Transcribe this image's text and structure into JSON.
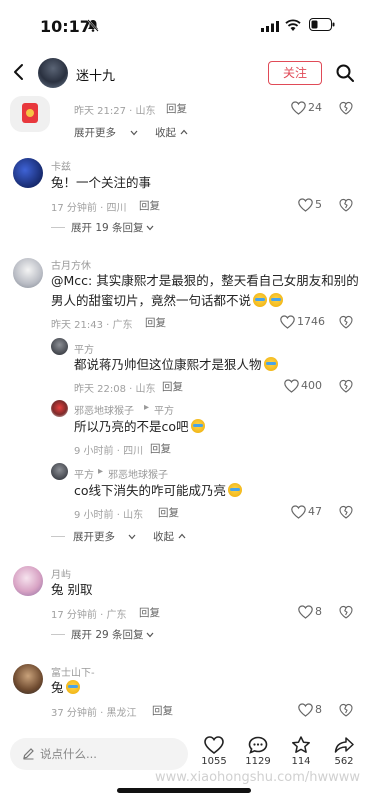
{
  "status": {
    "time": "10:17"
  },
  "header": {
    "name": "迷十九",
    "follow_label": "关注"
  },
  "comments": [
    {
      "meta": "昨天 21:27 · 山东",
      "reply": "回复",
      "likes": "24",
      "expand_more": "展开更多",
      "collapse": "收起"
    },
    {
      "user": "卡兹",
      "text": "兔！一个关注的事",
      "meta": "17 分钟前 · 四川",
      "reply": "回复",
      "likes": "5",
      "expand": "展开 19 条回复"
    },
    {
      "user": "古月方休",
      "text1": "@Mcc: 其实康熙才是最狠的，整天看自己女朋友和别的",
      "text2": "男人的甜蜜切片，竟然一句话都不说",
      "meta": "昨天 21:43 · 广东",
      "reply": "回复",
      "likes": "1746",
      "replies": [
        {
          "user": "平方",
          "text": "都说蒋乃帅但这位康熙才是狠人物",
          "meta": "昨天 22:08 · 山东",
          "reply": "回复",
          "likes": "400"
        },
        {
          "user": "邪恶地球猴子",
          "to": "平方",
          "text": "所以乃亮的不是co吧",
          "meta": "9 小时前 · 四川",
          "reply": "回复"
        },
        {
          "user": "平方",
          "to": "邪恶地球猴子",
          "text": "co线下消失的咋可能成乃亮",
          "meta": "9 小时前 · 山东",
          "reply": "回复",
          "likes": "47"
        }
      ],
      "expand_more": "展开更多",
      "collapse": "收起"
    },
    {
      "user": "月屿",
      "text": "兔 别取",
      "meta": "17 分钟前 · 广东",
      "reply": "回复",
      "likes": "8",
      "expand": "展开 29 条回复"
    },
    {
      "user": "富士山下-",
      "text": "兔",
      "meta": "37 分钟前 · 黑龙江",
      "reply": "回复",
      "likes": "8"
    }
  ],
  "bottom": {
    "placeholder": "说点什么...",
    "likes": "1055",
    "comments": "1129",
    "favorites": "114",
    "shares": "562"
  },
  "watermark": "www.xiaohongshu.com/hwwww",
  "colors": {
    "accent": "#e04a57"
  }
}
